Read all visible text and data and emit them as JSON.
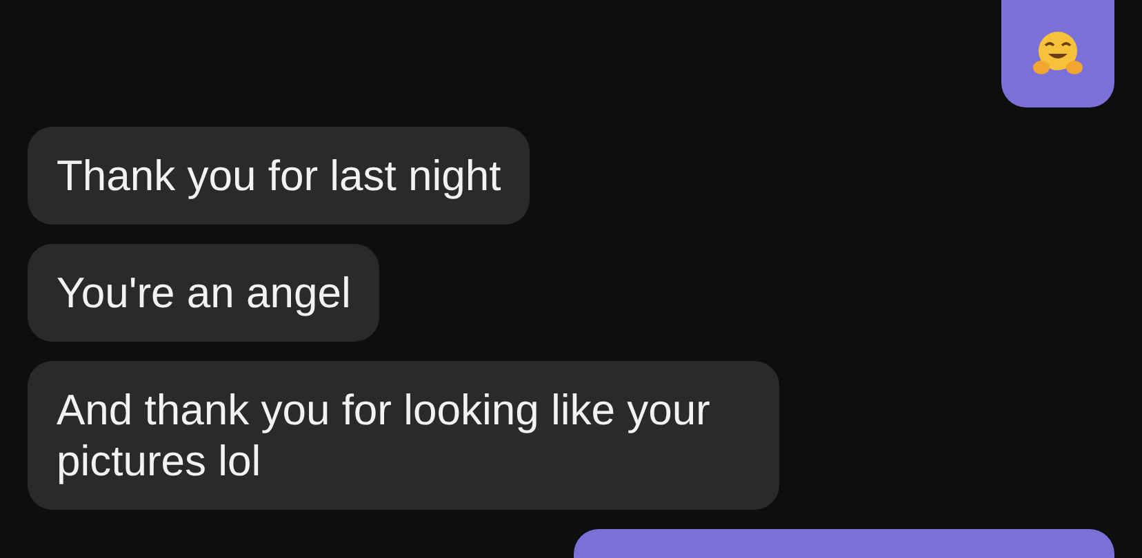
{
  "messages": [
    {
      "outgoing": true,
      "kind": "emoji"
    },
    {
      "outgoing": false,
      "kind": "text",
      "text": "Thank you for last night"
    },
    {
      "outgoing": false,
      "kind": "text",
      "text": "You're an angel"
    },
    {
      "outgoing": false,
      "kind": "text",
      "text": "And thank you for looking like your pictures lol"
    },
    {
      "outgoing": true,
      "kind": "blank"
    }
  ]
}
